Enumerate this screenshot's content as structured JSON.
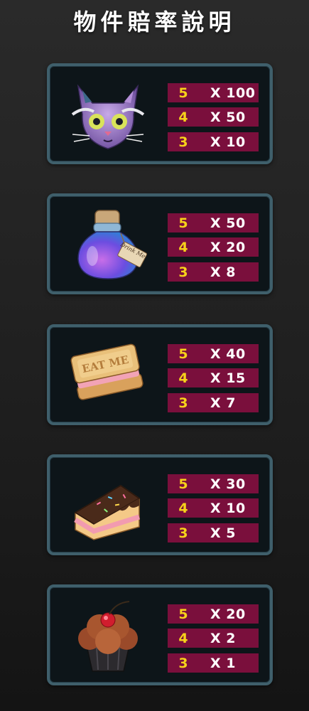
{
  "title": "物件賠率說明",
  "items": [
    {
      "icon": "cheshire-cat-icon",
      "payouts": [
        {
          "count": "5",
          "multiplier": "X 100"
        },
        {
          "count": "4",
          "multiplier": "X 50"
        },
        {
          "count": "3",
          "multiplier": "X 10"
        }
      ]
    },
    {
      "icon": "drink-me-potion-icon",
      "tag_text": "Drink Me",
      "payouts": [
        {
          "count": "5",
          "multiplier": "X 50"
        },
        {
          "count": "4",
          "multiplier": "X 20"
        },
        {
          "count": "3",
          "multiplier": "X 8"
        }
      ]
    },
    {
      "icon": "eat-me-cookie-icon",
      "stamp_text": "EAT ME",
      "payouts": [
        {
          "count": "5",
          "multiplier": "X 40"
        },
        {
          "count": "4",
          "multiplier": "X 15"
        },
        {
          "count": "3",
          "multiplier": "X 7"
        }
      ]
    },
    {
      "icon": "chocolate-cake-slice-icon",
      "payouts": [
        {
          "count": "5",
          "multiplier": "X 30"
        },
        {
          "count": "4",
          "multiplier": "X 10"
        },
        {
          "count": "3",
          "multiplier": "X 5"
        }
      ]
    },
    {
      "icon": "cherry-cupcake-icon",
      "payouts": [
        {
          "count": "5",
          "multiplier": "X 20"
        },
        {
          "count": "4",
          "multiplier": "X 2"
        },
        {
          "count": "3",
          "multiplier": "X 1"
        }
      ]
    }
  ],
  "colors": {
    "row_background": "#7a0f3c",
    "count_text": "#f7d21a",
    "multiplier_text": "#ffffff",
    "card_border": "#3f5f6b",
    "card_background": "#0d1519"
  }
}
